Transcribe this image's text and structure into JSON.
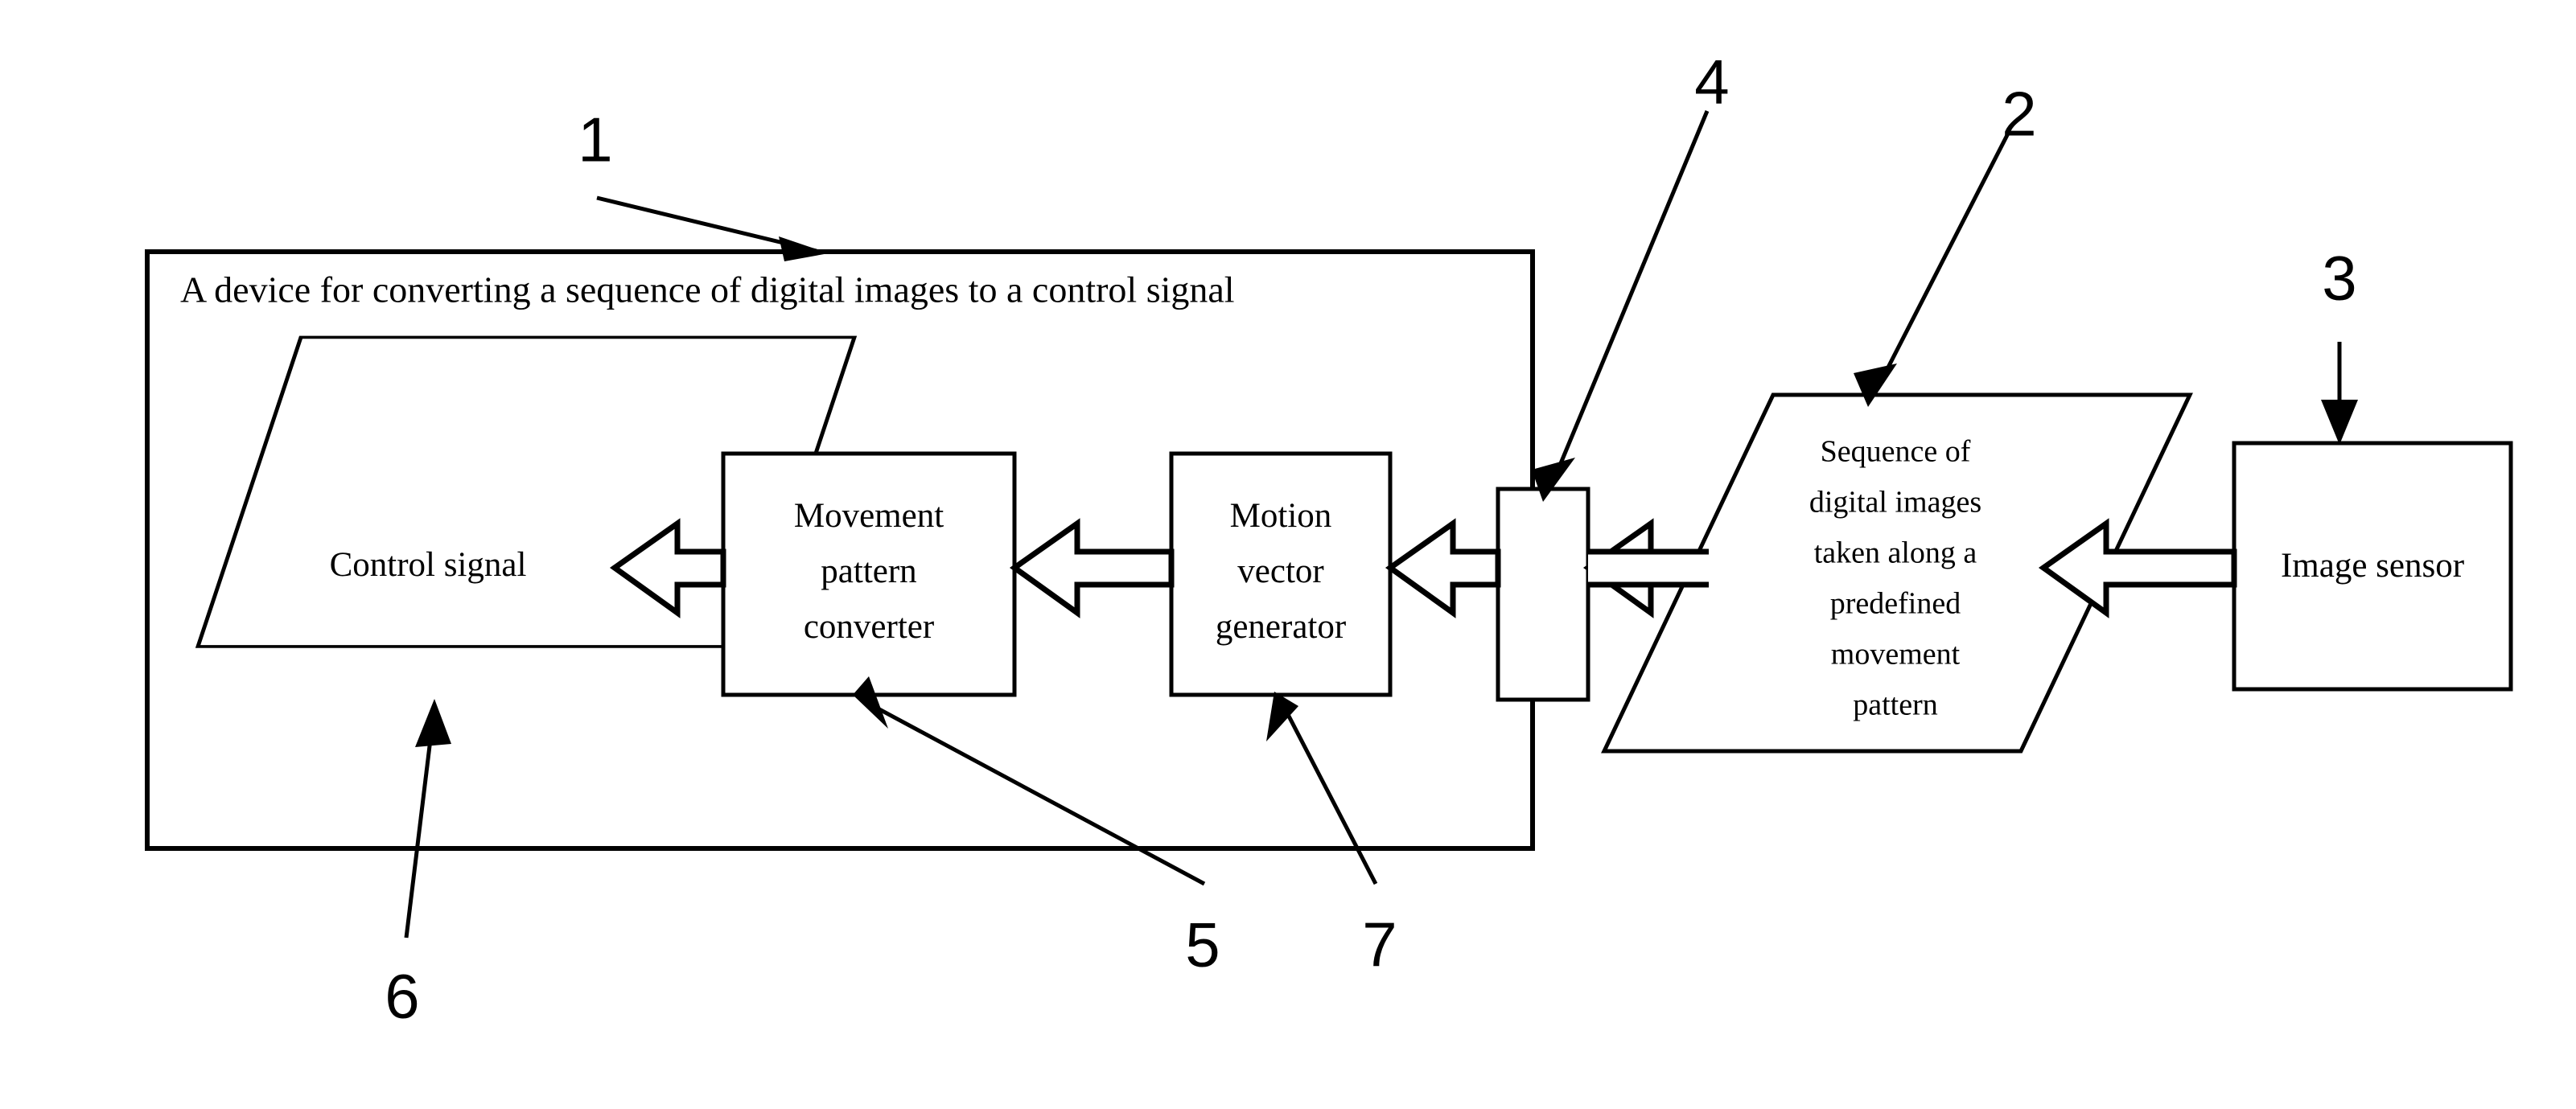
{
  "figure": {
    "kind": "patent-block-diagram",
    "background_color": "#ffffff",
    "line_color": "#000000"
  },
  "device": {
    "title": "A device for converting a sequence of digital images to a control signal",
    "reference_numeral": "1"
  },
  "blocks": {
    "control_signal": {
      "shape": "parallelogram",
      "label": "Control signal",
      "reference_numeral": "6"
    },
    "movement_pattern_converter": {
      "shape": "rectangle",
      "line1": "Movement",
      "line2": "pattern",
      "line3": "converter",
      "reference_numeral": "5"
    },
    "motion_vector_generator": {
      "shape": "rectangle",
      "line1": "Motion",
      "line2": "vector",
      "line3": "generator",
      "reference_numeral": "7"
    },
    "interface": {
      "shape": "rectangle",
      "label": "",
      "reference_numeral": "4"
    },
    "sequence_of_images": {
      "shape": "parallelogram",
      "line1": "Sequence of",
      "line2": "digital images",
      "line3": "taken along a",
      "line4": "predefined",
      "line5": "movement",
      "line6": "pattern",
      "reference_numeral": "2"
    },
    "image_sensor": {
      "shape": "rectangle",
      "label": "Image sensor",
      "reference_numeral": "3"
    }
  },
  "flow_arrows": [
    {
      "name": "sensor-to-sequence",
      "style": "hollow-block-arrow",
      "direction": "left"
    },
    {
      "name": "sequence-to-interface",
      "style": "hollow-block-arrow",
      "direction": "left"
    },
    {
      "name": "interface-to-motion-vector-generator",
      "style": "hollow-block-arrow",
      "direction": "left"
    },
    {
      "name": "motion-vector-generator-to-movement-pattern-converter",
      "style": "hollow-block-arrow",
      "direction": "left"
    },
    {
      "name": "movement-pattern-converter-to-control-signal",
      "style": "hollow-block-arrow",
      "direction": "left"
    }
  ],
  "numerals": {
    "n1": "1",
    "n2": "2",
    "n3": "3",
    "n4": "4",
    "n5": "5",
    "n6": "6",
    "n7": "7"
  }
}
